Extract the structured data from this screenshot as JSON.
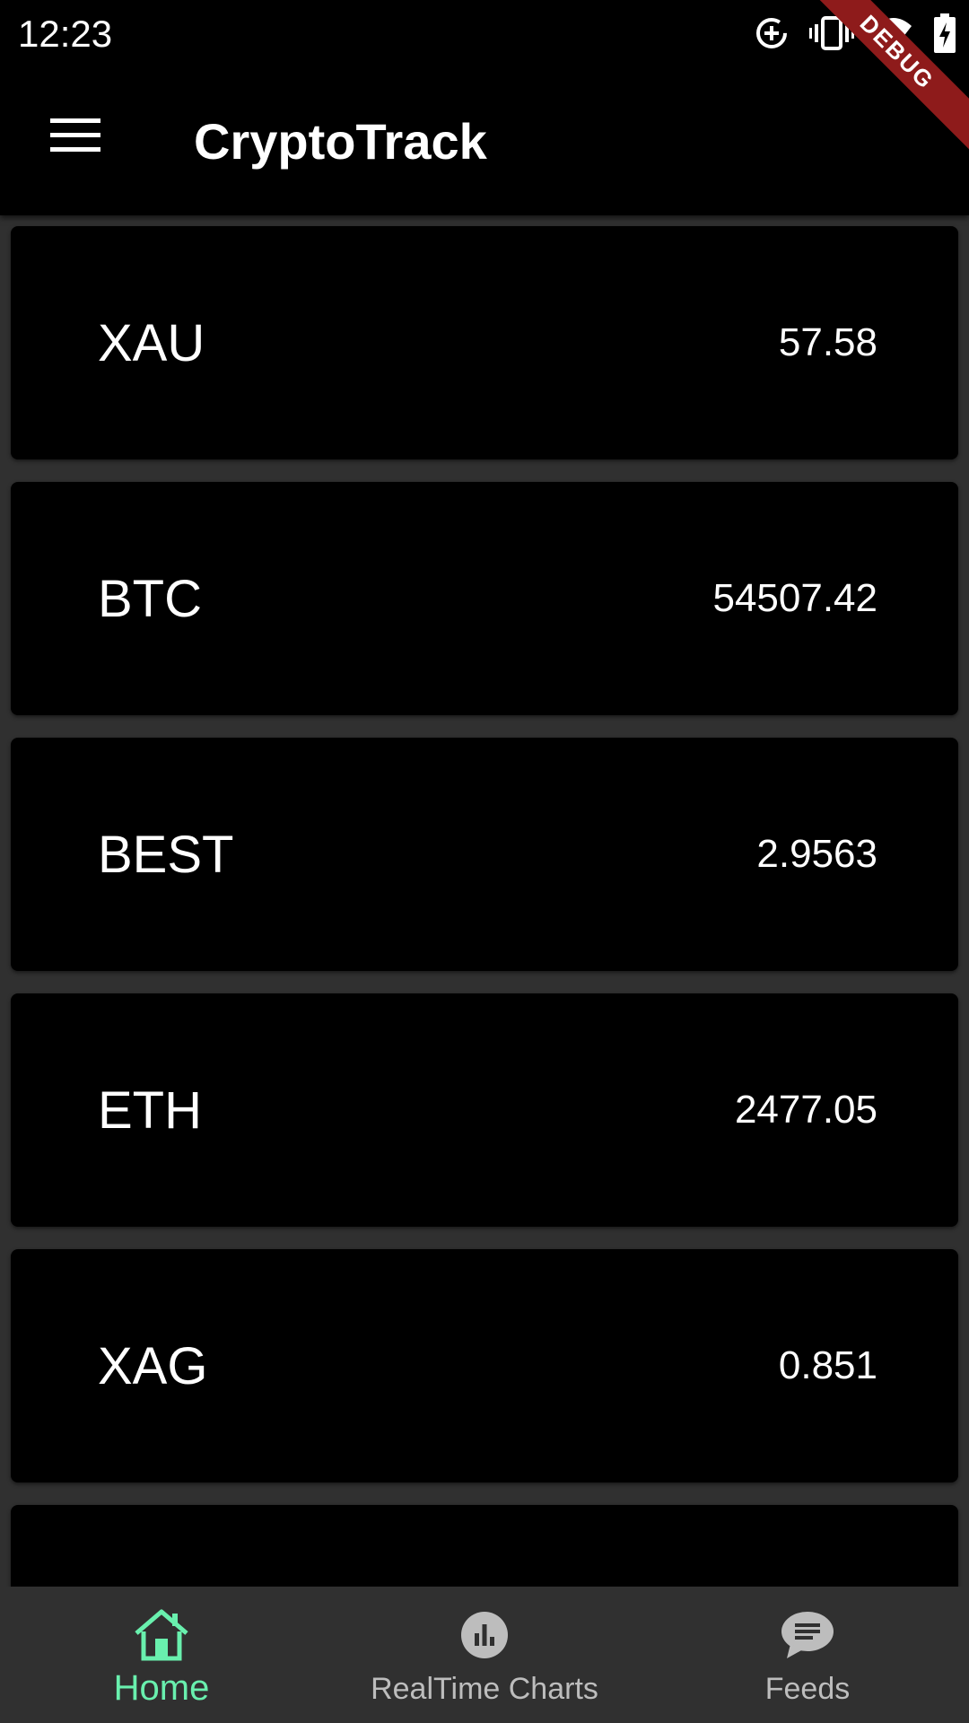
{
  "status_bar": {
    "time": "12:23",
    "icons": [
      "data-saver-icon",
      "vibrate-icon",
      "wifi-icon",
      "battery-charging-icon"
    ]
  },
  "debug_banner": "DEBUG",
  "app_bar": {
    "menu_icon": "menu-icon",
    "title": "CryptoTrack"
  },
  "assets": [
    {
      "symbol": "XAU",
      "price": "57.58"
    },
    {
      "symbol": "BTC",
      "price": "54507.42"
    },
    {
      "symbol": "BEST",
      "price": "2.9563"
    },
    {
      "symbol": "ETH",
      "price": "2477.05"
    },
    {
      "symbol": "XAG",
      "price": "0.851"
    },
    {
      "symbol": "",
      "price": ""
    }
  ],
  "bottom_nav": {
    "items": [
      {
        "label": "Home",
        "icon": "home-icon",
        "active": true
      },
      {
        "label": "RealTime Charts",
        "icon": "chart-icon",
        "active": false
      },
      {
        "label": "Feeds",
        "icon": "chat-bubble-icon",
        "active": false
      }
    ]
  },
  "colors": {
    "background": "#303030",
    "surface": "#000000",
    "accent": "#69f0ae",
    "inactive": "#bdbdbd",
    "debug": "#8e1b1b"
  }
}
